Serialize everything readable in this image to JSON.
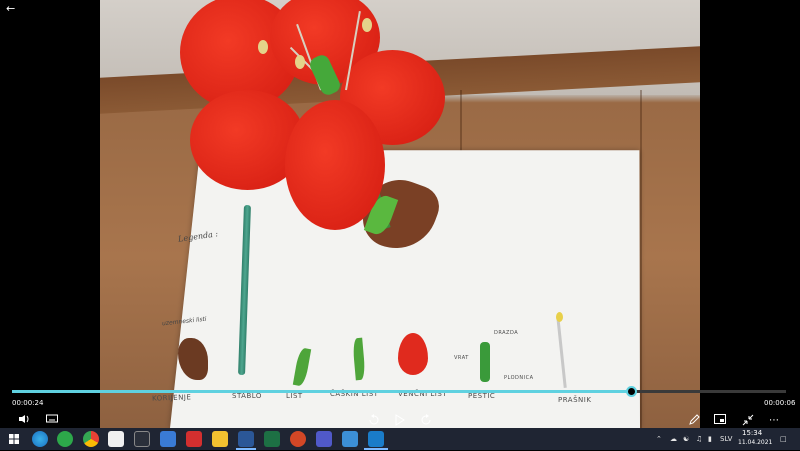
{
  "player": {
    "back_icon": "arrow-left-icon",
    "current_time": "00:00:24",
    "total_time": "00:00:06",
    "progress": 0.8,
    "accent": "#5fd1e0"
  },
  "photo": {
    "legend_heading": "Legenda :",
    "small_note": "uzemneski listi",
    "labels": {
      "root": "KORIJENJE",
      "stem": "STABLO",
      "leaf": "LIST",
      "sepal": "ČAŠKIN LIST",
      "petal": "VENČNI LIST",
      "pistil": "PESTIĆ",
      "stamen": "PRAŠNIK",
      "stigma": "DRAZDA",
      "style": "VRAT",
      "ovary": "PLODNICA"
    }
  },
  "controls": {
    "volume_icon": "volume-icon",
    "subtitles_icon": "subtitles-icon",
    "rewind_icon": "rewind-10-icon",
    "play_icon": "play-icon",
    "forward_icon": "forward-30-icon",
    "edit_icon": "pencil-icon",
    "miniview_icon": "mini-view-icon",
    "fullscreen_icon": "exit-fullscreen-icon",
    "more_icon": "more-icon"
  },
  "taskbar": {
    "language": "SLV",
    "time": "15:34",
    "date": "11.04.2021"
  }
}
